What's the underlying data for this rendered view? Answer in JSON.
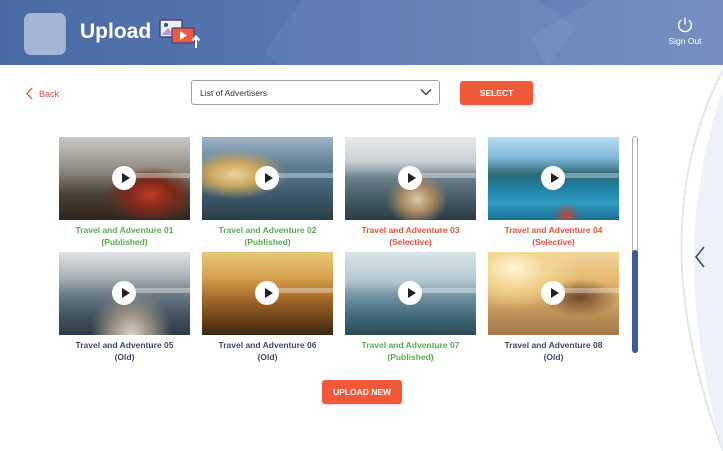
{
  "header": {
    "title": "Upload",
    "signout_label": "Sign Out"
  },
  "back_label": "Back",
  "dropdown": {
    "selected": "List of Advertisers"
  },
  "select_label": "SELECT",
  "upload_new_label": "UPLOAD NEW",
  "videos": [
    {
      "title": "Travel and Adventure 01",
      "status": "(Published)",
      "status_type": "published"
    },
    {
      "title": "Travel and Adventure 02",
      "status": "(Published)",
      "status_type": "published"
    },
    {
      "title": "Travel and Adventure 03",
      "status": "(Selective)",
      "status_type": "selective"
    },
    {
      "title": "Travel and Adventure 04",
      "status": "(Selective)",
      "status_type": "selective"
    },
    {
      "title": "Travel and Adventure 05",
      "status": "(Old)",
      "status_type": "old"
    },
    {
      "title": "Travel and Adventure 06",
      "status": "(Old)",
      "status_type": "old"
    },
    {
      "title": "Travel and Adventure 07",
      "status": "(Published)",
      "status_type": "published"
    },
    {
      "title": "Travel and Adventure 08",
      "status": "(Old)",
      "status_type": "old"
    }
  ],
  "colors": {
    "header": "#4a6aa6",
    "accent": "#f2593b",
    "published": "#5aab55",
    "selective": "#e5533c",
    "old": "#3d4a6b"
  },
  "scroll_position": 0.52
}
